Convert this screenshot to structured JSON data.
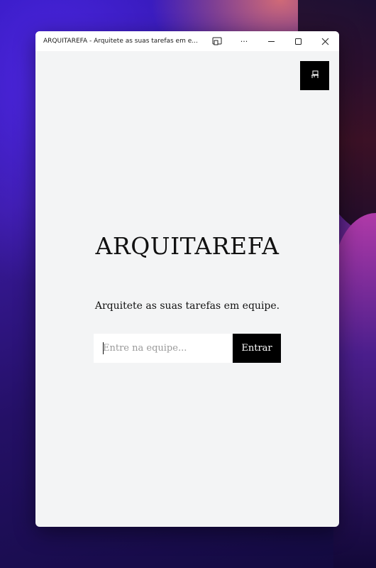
{
  "window": {
    "title": "ARQUITAREFA - Arquitete as suas tarefas em e...",
    "more_label": "···"
  },
  "app": {
    "title": "ARQUITAREFA",
    "subtitle": "Arquitete as suas tarefas em equipe.",
    "team_input": {
      "placeholder": "Entre na equipe...",
      "value": ""
    },
    "enter_button_label": "Entrar",
    "mode_toggle_icon": "chair-icon"
  },
  "colors": {
    "app_background": "#f3f4f5",
    "button_background": "#000000",
    "button_text": "#ffffff"
  }
}
